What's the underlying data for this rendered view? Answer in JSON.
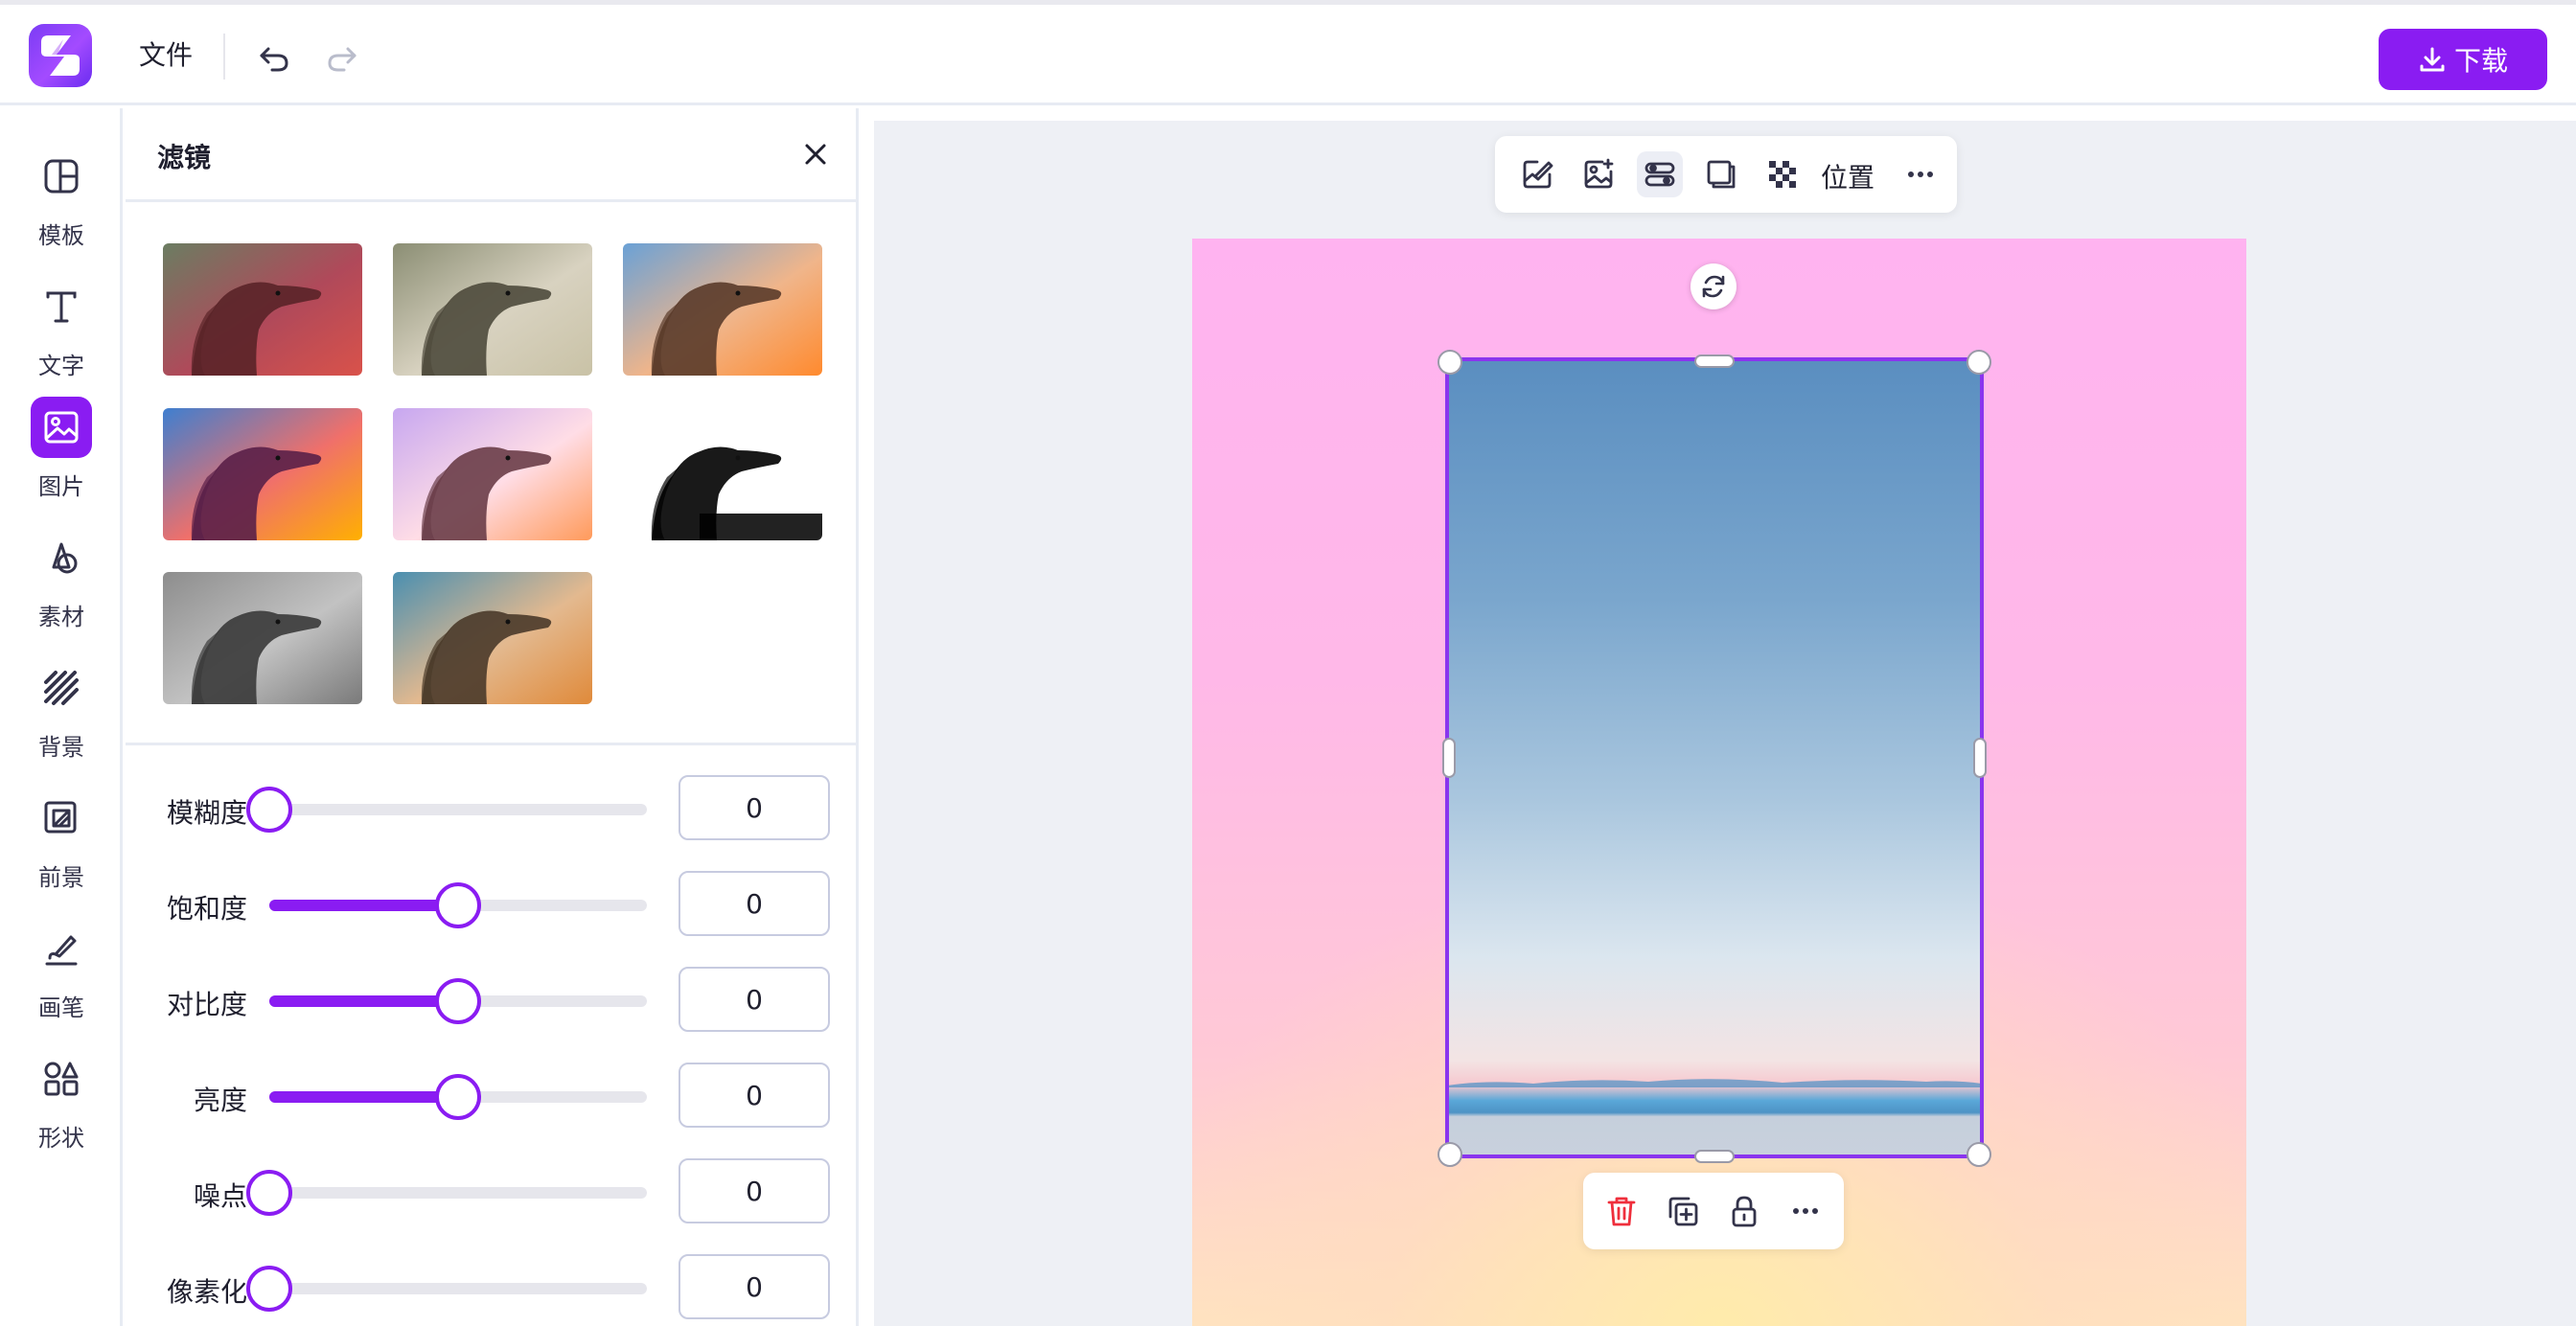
{
  "header": {
    "file_menu": "文件",
    "download_label": "下载"
  },
  "rail": {
    "items": [
      {
        "label": "模板",
        "icon": "template-icon"
      },
      {
        "label": "文字",
        "icon": "text-icon"
      },
      {
        "label": "图片",
        "icon": "image-icon",
        "active": true
      },
      {
        "label": "素材",
        "icon": "shapes-icon"
      },
      {
        "label": "背景",
        "icon": "background-icon"
      },
      {
        "label": "前景",
        "icon": "foreground-icon"
      },
      {
        "label": "画笔",
        "icon": "brush-icon"
      },
      {
        "label": "形状",
        "icon": "shape-icon"
      }
    ]
  },
  "filter_panel": {
    "title": "滤镜",
    "filters_count": 8,
    "sliders": [
      {
        "label": "模糊度",
        "value": "0",
        "level": 0
      },
      {
        "label": "饱和度",
        "value": "0",
        "level": 0.5
      },
      {
        "label": "对比度",
        "value": "0",
        "level": 0.5
      },
      {
        "label": "亮度",
        "value": "0",
        "level": 0.5
      },
      {
        "label": "噪点",
        "value": "0",
        "level": 0
      },
      {
        "label": "像素化",
        "value": "0",
        "level": 0
      }
    ]
  },
  "canvas_toolbar": {
    "position_label": "位置"
  },
  "colors": {
    "accent": "#8a1cf2",
    "delete": "#ef2f3c"
  }
}
